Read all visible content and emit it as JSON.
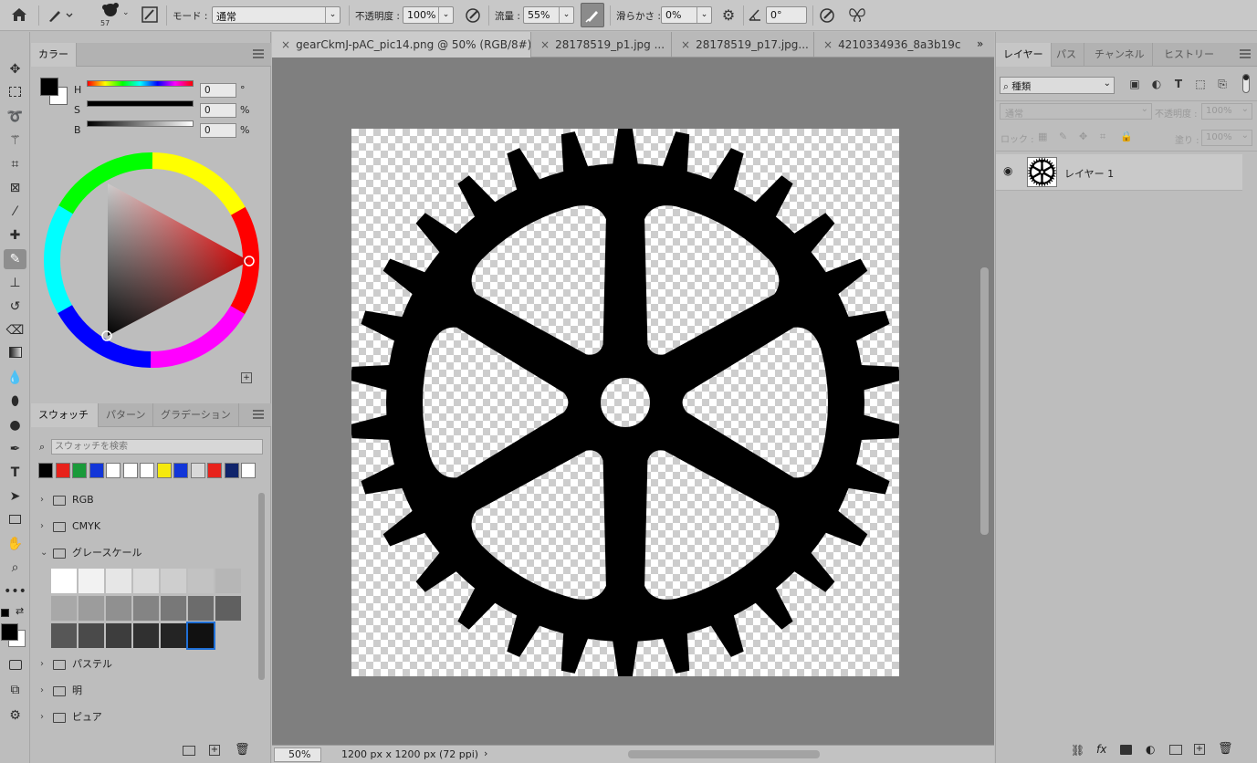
{
  "options_bar": {
    "brush_size": "57",
    "mode_label": "モード :",
    "mode_value": "通常",
    "opacity_label": "不透明度 :",
    "opacity_value": "100%",
    "flow_label": "流量 :",
    "flow_value": "55%",
    "smoothing_label": "滑らかさ :",
    "smoothing_value": "0%",
    "angle_value": "0°"
  },
  "color_panel": {
    "tab": "カラー",
    "h_label": "H",
    "h_value": "0",
    "h_unit": "°",
    "s_label": "S",
    "s_value": "0",
    "s_unit": "%",
    "b_label": "B",
    "b_value": "0",
    "b_unit": "%"
  },
  "swatch_panel": {
    "tabs": [
      "スウォッチ",
      "パターン",
      "グラデーション"
    ],
    "search_placeholder": "スウォッチを検索",
    "recent_colors": [
      "#000000",
      "#e8221b",
      "#1a9a3a",
      "#1236d8",
      "#ffffff",
      "#ffffff",
      "#ffffff",
      "#f5e90d",
      "#1236d8",
      "#d9d9d9",
      "#e8221b",
      "#10246b",
      "#ffffff"
    ],
    "folders": [
      {
        "name": "RGB",
        "expanded": false
      },
      {
        "name": "CMYK",
        "expanded": false
      },
      {
        "name": "グレースケール",
        "expanded": true
      },
      {
        "name": "パステル",
        "expanded": false
      },
      {
        "name": "明",
        "expanded": false
      },
      {
        "name": "ピュア",
        "expanded": false
      }
    ],
    "grayscale": [
      [
        "#ffffff",
        "#f2f2f2",
        "#e6e6e6",
        "#dadada",
        "#cecece",
        "#c2c2c2",
        "#b6b6b6"
      ],
      [
        "#a8a8a8",
        "#9c9c9c",
        "#909090",
        "#848484",
        "#787878",
        "#6c6c6c",
        "#606060"
      ],
      [
        "#575757",
        "#4a4a4a",
        "#3d3d3d",
        "#303030",
        "#242424",
        "#111111"
      ]
    ]
  },
  "document": {
    "tabs": [
      {
        "label": "gearCkmJ-pAC_pic14.png @ 50% (RGB/8#)",
        "active": true
      },
      {
        "label": "28178519_p1.jpg ...",
        "active": false
      },
      {
        "label": "28178519_p17.jpg...",
        "active": false
      },
      {
        "label": "4210334936_8a3b19c",
        "active": false
      }
    ],
    "zoom": "50%",
    "size_info": "1200 px x 1200 px (72 ppi)"
  },
  "layers_panel": {
    "tabs": [
      "レイヤー",
      "パス",
      "チャンネル",
      "ヒストリー"
    ],
    "filter_value": "種類",
    "blend_mode": "通常",
    "opacity_label": "不透明度 :",
    "opacity_value": "100%",
    "lock_label": "ロック :",
    "fill_label": "塗り :",
    "fill_value": "100%",
    "layers": [
      {
        "name": "レイヤー 1",
        "visible": true
      }
    ]
  }
}
